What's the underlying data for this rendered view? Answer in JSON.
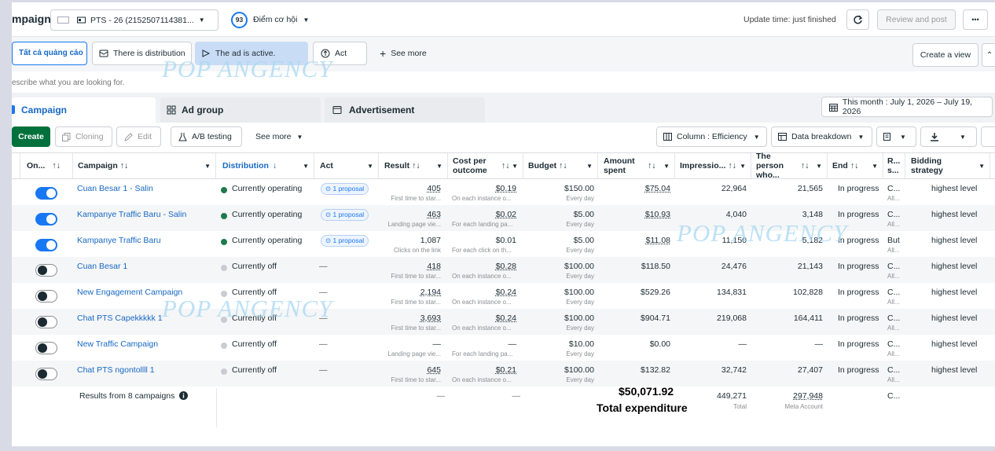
{
  "header": {
    "title": "mpaign",
    "account": "PTS - 26 (2152507114381...",
    "score": "93",
    "opportunities": "Điểm cơ hội",
    "update_time": "Update time: just finished",
    "review_button": "Review and post",
    "more_button": "•••"
  },
  "filters": {
    "all_ads": "Tất cả quảng cáo",
    "distribution": "There is distribution",
    "active": "The ad is active.",
    "act": "Act",
    "see_more": "See more",
    "create_view": "Create a view"
  },
  "search": {
    "placeholder": "escribe what you are looking for."
  },
  "tabs": {
    "campaign": "Campaign",
    "ad_group": "Ad group",
    "advertisement": "Advertisement",
    "date_range": "This month : July 1, 2026 – July 19, 2026"
  },
  "toolbar": {
    "create": "Create",
    "cloning": "Cloning",
    "edit": "Edit",
    "ab_testing": "A/B testing",
    "see_more": "See more",
    "column": "Column : Efficiency",
    "data_breakdown": "Data breakdown"
  },
  "columns": {
    "on": "On...",
    "campaign": "Campaign",
    "distribution": "Distribution",
    "act": "Act",
    "result": "Result",
    "cost_per_outcome": "Cost per outcome",
    "budget": "Budget",
    "amount_spent": "Amount spent",
    "impressions": "Impressio...",
    "reach": "The person who...",
    "end": "End",
    "rs": "R... s...",
    "bidding": "Bidding strategy"
  },
  "rows": [
    {
      "on": true,
      "campaign": "Cuan Besar 1 - Salin",
      "distribution": "Currently operating",
      "active": true,
      "act": "1 proposal",
      "result": "405",
      "result_sub": "First time to star...",
      "cost": "$0.19",
      "cost_sub": "On each instance o...",
      "budget": "$150.00",
      "budget_sub": "Every day",
      "spent": "$75.04",
      "impressions": "22,964",
      "reach": "21,565",
      "end": "In progress",
      "rs": "C...",
      "rs_sub": "All...",
      "bidding": "highest level"
    },
    {
      "on": true,
      "campaign": "Kampanye Traffic Baru - Salin",
      "distribution": "Currently operating",
      "active": true,
      "act": "1 proposal",
      "result": "463",
      "result_sub": "Landing page vie...",
      "cost": "$0.02",
      "cost_sub": "For each landing pa...",
      "budget": "$5.00",
      "budget_sub": "Every day",
      "spent": "$10.93",
      "impressions": "4,040",
      "reach": "3,148",
      "end": "In progress",
      "rs": "C...",
      "rs_sub": "All...",
      "bidding": "highest level"
    },
    {
      "on": true,
      "campaign": "Kampanye Traffic Baru",
      "distribution": "Currently operating",
      "active": true,
      "act": "1 proposal",
      "result": "1,087",
      "result_sub": "Clicks on the link",
      "cost": "$0.01",
      "cost_sub": "For each click on th...",
      "budget": "$5.00",
      "budget_sub": "Every day",
      "spent": "$11.08",
      "impressions": "11,150",
      "reach": "5,182",
      "end": "In progress",
      "rs": "But",
      "rs_sub": "All...",
      "bidding": "highest level"
    },
    {
      "on": false,
      "campaign": "Cuan Besar 1",
      "distribution": "Currently off",
      "active": false,
      "act": "—",
      "result": "418",
      "result_sub": "First time to star...",
      "cost": "$0.28",
      "cost_sub": "On each instance o...",
      "budget": "$100.00",
      "budget_sub": "Every day",
      "spent": "$118.50",
      "impressions": "24,476",
      "reach": "21,143",
      "end": "In progress",
      "rs": "C...",
      "rs_sub": "All...",
      "bidding": "highest level"
    },
    {
      "on": false,
      "campaign": "New Engagement Campaign",
      "distribution": "Currently off",
      "active": false,
      "act": "—",
      "result": "2,194",
      "result_sub": "First time to star...",
      "cost": "$0.24",
      "cost_sub": "On each instance o...",
      "budget": "$100.00",
      "budget_sub": "Every day",
      "spent": "$529.26",
      "impressions": "134,831",
      "reach": "102,828",
      "end": "In progress",
      "rs": "C...",
      "rs_sub": "All...",
      "bidding": "highest level"
    },
    {
      "on": false,
      "campaign": "Chat PTS Capekkkkk 1",
      "distribution": "Currently off",
      "active": false,
      "act": "—",
      "result": "3,693",
      "result_sub": "First time to star...",
      "cost": "$0.24",
      "cost_sub": "On each instance o...",
      "budget": "$100.00",
      "budget_sub": "Every day",
      "spent": "$904.71",
      "impressions": "219,068",
      "reach": "164,411",
      "end": "In progress",
      "rs": "C...",
      "rs_sub": "All...",
      "bidding": "highest level"
    },
    {
      "on": false,
      "campaign": "New Traffic Campaign",
      "distribution": "Currently off",
      "active": false,
      "act": "—",
      "result": "—",
      "result_sub": "Landing page vie...",
      "cost": "—",
      "cost_sub": "For each landing pa...",
      "budget": "$10.00",
      "budget_sub": "Every day",
      "spent": "$0.00",
      "impressions": "—",
      "reach": "—",
      "end": "In progress",
      "rs": "C...",
      "rs_sub": "All...",
      "bidding": "highest level"
    },
    {
      "on": false,
      "campaign": "Chat PTS ngontollll 1",
      "distribution": "Currently off",
      "active": false,
      "act": "—",
      "result": "645",
      "result_sub": "First time to star...",
      "cost": "$0.21",
      "cost_sub": "On each instance o...",
      "budget": "$100.00",
      "budget_sub": "Every day",
      "spent": "$132.82",
      "impressions": "32,742",
      "reach": "27,407",
      "end": "In progress",
      "rs": "C...",
      "rs_sub": "All...",
      "bidding": "highest level"
    }
  ],
  "totals": {
    "label": "Results from 8 campaigns",
    "result": "—",
    "cost": "—",
    "spent_overlay": "$50,071.92",
    "spent_overlay_label": "Total expenditure",
    "impressions": "449,271",
    "impressions_sub": "Total",
    "reach": "297,948",
    "reach_sub": "Meta Account",
    "rs": "C..."
  },
  "watermark": "POP ANGENCY",
  "colors": {
    "primary": "#1877f2",
    "create_button": "#00703c",
    "operating_dot": "#1f7a4d",
    "off_dot": "#c9ccd1",
    "link": "#1768c4",
    "active_filter": "#c9dcf5"
  }
}
